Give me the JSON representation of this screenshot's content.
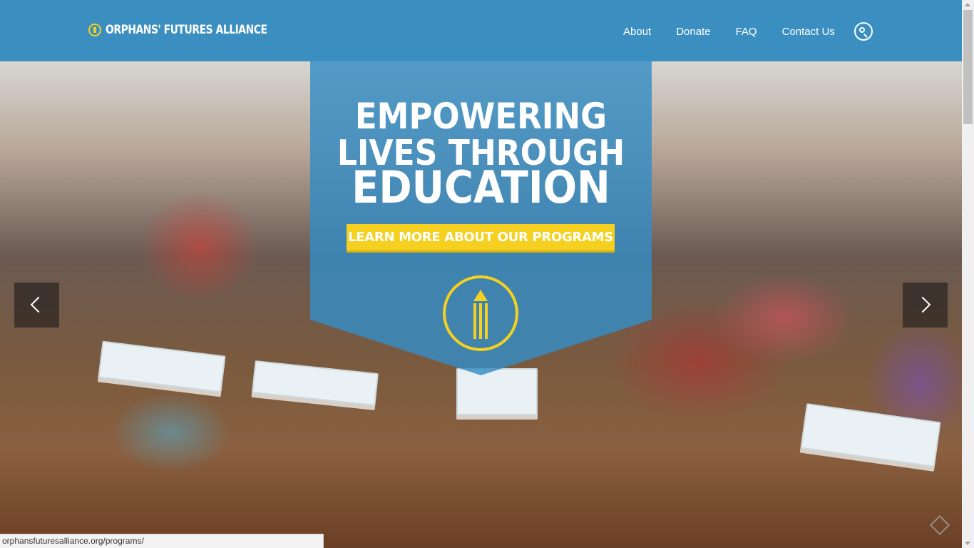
{
  "header": {
    "logo_text": "ORPHANS' FUTURES ALLIANCE",
    "nav": {
      "about": "About",
      "donate": "Donate",
      "faq": "FAQ",
      "contact": "Contact Us"
    },
    "search_icon": "search-icon",
    "background_color": "#3a8fc0"
  },
  "hero": {
    "headline_line1": "EMPOWERING",
    "headline_line2": "LIVES THROUGH",
    "headline_line3": "EDUCATION",
    "cta_label": "LEARN MORE ABOUT OUR PROGRAMS",
    "accent_color": "#f5d020",
    "badge_icon": "pencil-icon",
    "prev_icon": "chevron-left-icon",
    "next_icon": "chevron-right-icon"
  },
  "statusbar": {
    "url": "orphansfuturesalliance.org/programs/"
  }
}
